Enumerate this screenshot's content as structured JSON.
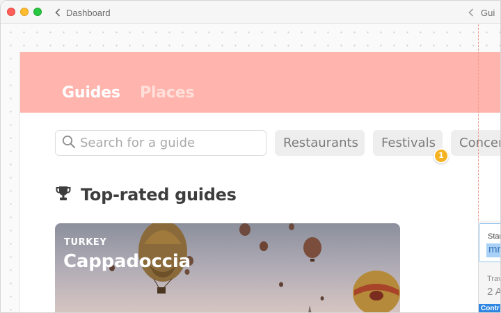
{
  "titlebar": {
    "back_label": "Dashboard",
    "right_label": "Gui"
  },
  "tabs": [
    {
      "label": "Guides",
      "active": true
    },
    {
      "label": "Places",
      "active": false
    }
  ],
  "search": {
    "placeholder": "Search for a guide"
  },
  "chips": [
    {
      "label": "Restaurants"
    },
    {
      "label": "Festivals"
    },
    {
      "label": "Concer"
    }
  ],
  "badge": "1",
  "section": {
    "title": "Top-rated guides",
    "icon": "trophy-icon"
  },
  "card": {
    "country": "TURKEY",
    "title": "Cappadoccia"
  },
  "panel": {
    "field1_label": "Star",
    "field1_value": "mr",
    "field2_label": "Trav",
    "field2_value": "2 A",
    "tag": "Contr"
  },
  "colors": {
    "header": "#ffb5ad",
    "badge": "#f5b321",
    "guide_line": "#f19a8a",
    "selection": "#a9d1f7"
  }
}
